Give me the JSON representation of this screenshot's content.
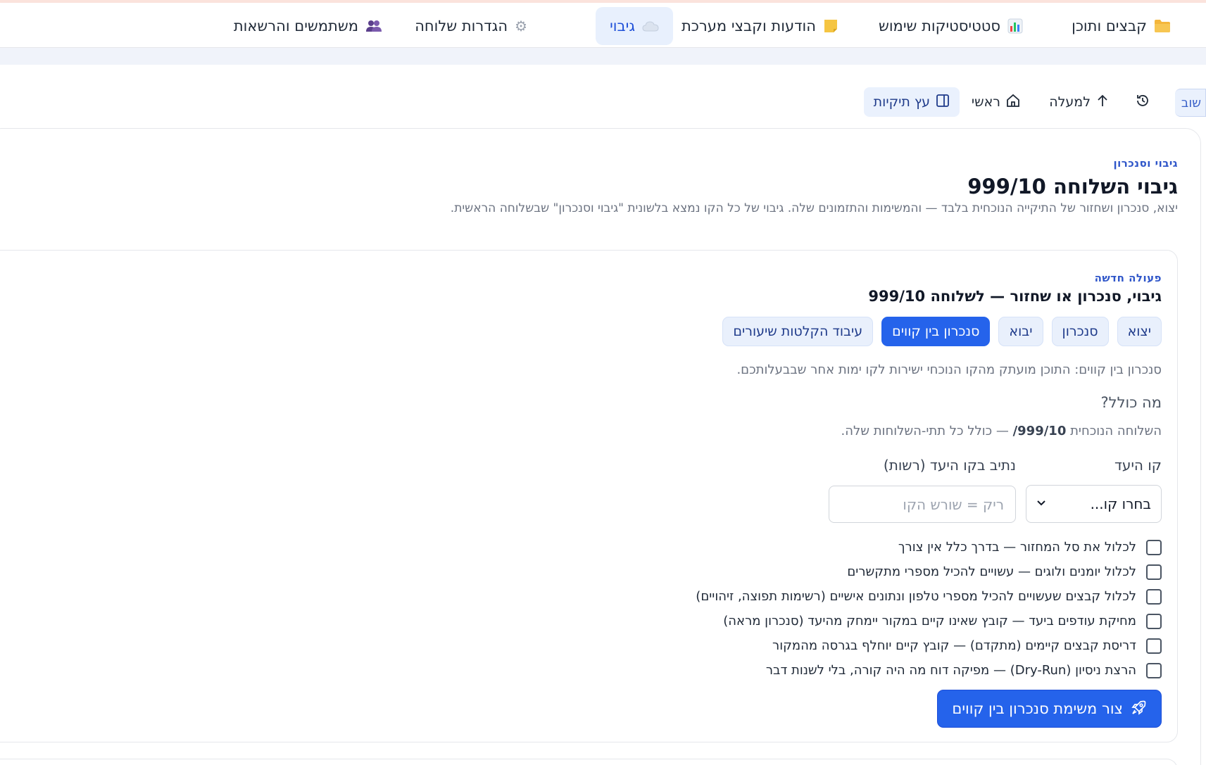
{
  "topnav": {
    "items": [
      {
        "label": "קבצים ותוכן",
        "icon": "folder-icon"
      },
      {
        "label": "סטטיסטיקות שימוש",
        "icon": "bar-chart-icon"
      },
      {
        "label": "הודעות וקבצי מערכת",
        "icon": "note-icon"
      },
      {
        "label": "גיבוי",
        "icon": "cloud-icon",
        "active": true
      },
      {
        "label": "הגדרות שלוחה",
        "icon": "gear-icon"
      },
      {
        "label": "משתמשים והרשאות",
        "icon": "users-icon"
      }
    ]
  },
  "toolbar": {
    "edge_label": "שוב",
    "history_icon": "history-icon",
    "up_label": "למעלה",
    "home_label": "ראשי",
    "folder_tree_label": "עץ תיקיות"
  },
  "header": {
    "eyebrow": "גיבוי וסנכרון",
    "title": "גיבוי השלוחה 999/10",
    "subtitle": "יצוא, סנכרון ושחזור של התיקייה הנוכחית בלבד — והמשימות והתזמונים שלה. גיבוי של כל הקו נמצא בלשונית \"גיבוי וסנכרון\" שבשלוחה הראשית."
  },
  "panel": {
    "eyebrow": "פעולה חדשה",
    "title": "גיבוי, סנכרון או שחזור — לשלוחה 999/10",
    "tabs": [
      {
        "label": "יצוא"
      },
      {
        "label": "סנכרון"
      },
      {
        "label": "יבוא"
      },
      {
        "label": "סנכרון בין קווים",
        "active": true
      },
      {
        "label": "עיבוד הקלטות שיעורים"
      }
    ],
    "description": "סנכרון בין קווים: התוכן מועתק מהקו הנוכחי ישירות לקו ימות אחר שבבעלותכם.",
    "includes_heading": "מה כולל?",
    "includes_prefix": "השלוחה הנוכחית",
    "includes_path": "/999/10",
    "includes_suffix": "— כולל כל תתי-השלוחות שלה.",
    "target_line_label": "קו היעד",
    "target_line_value": "בחרו קו...",
    "target_path_label": "נתיב בקו היעד (רשות)",
    "target_path_placeholder": "ריק = שורש הקו",
    "checkboxes": [
      {
        "label": "לכלול את סל המחזור — בדרך כלל אין צורך",
        "checked": false
      },
      {
        "label": "לכלול יומנים ולוגים — עשויים להכיל מספרי מתקשרים",
        "checked": false
      },
      {
        "label": "לכלול קבצים שעשויים להכיל מספרי טלפון ונתונים אישיים (רשימות תפוצה, זיהויים)",
        "checked": false
      },
      {
        "label": "מחיקת עודפים ביעד — קובץ שאינו קיים במקור יימחק מהיעד (סנכרון מראה)",
        "checked": false
      },
      {
        "label": "דריסת קבצים קיימים (מתקדם) — קובץ קיים יוחלף בגרסה מהמקור",
        "checked": false
      },
      {
        "label": "הרצת ניסיון (Dry-Run) — מפיקה דוח מה היה קורה, בלי לשנות דבר",
        "checked": false
      }
    ],
    "submit_label": "צור משימת סנכרון בין קווים"
  },
  "colors": {
    "accent": "#2563eb",
    "accent_soft": "#e9f0fc",
    "eyebrow": "#2f56c9"
  }
}
